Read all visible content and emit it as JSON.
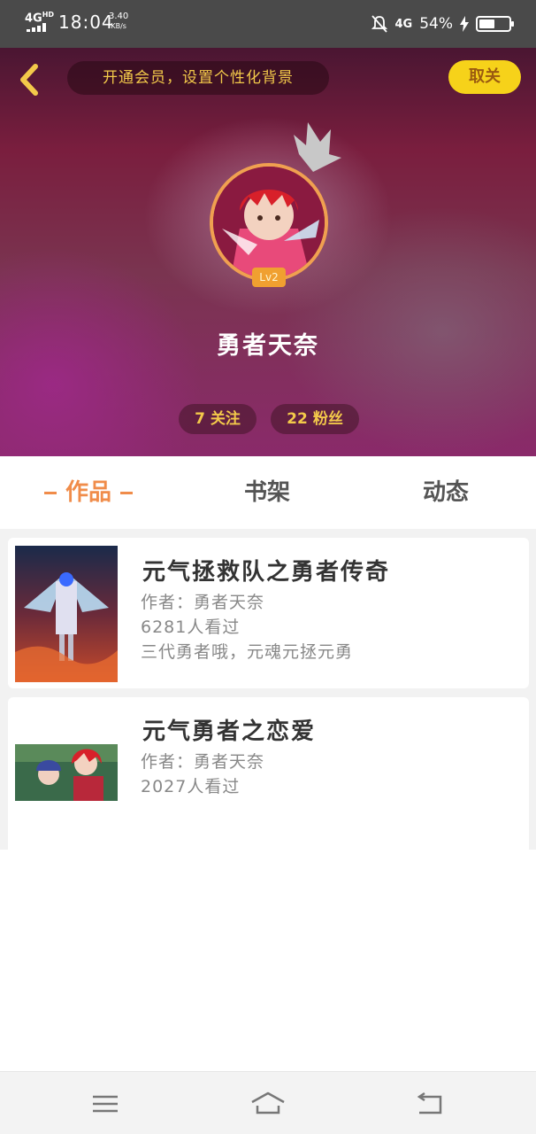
{
  "status_bar": {
    "network": "4G",
    "network_sup": "HD",
    "time": "18:04",
    "speed_value": "3.40",
    "speed_unit": "KB/s",
    "signal_label": "4G",
    "battery_percent": "54%",
    "battery_level": 0.54
  },
  "header": {
    "vip_banner": "开通会员，设置个性化背景",
    "unfollow_label": "取关",
    "level": "Lv2",
    "username": "勇者天奈",
    "following_count": "7",
    "following_label": "关注",
    "followers_count": "22",
    "followers_label": "粉丝"
  },
  "tabs": [
    {
      "label": "作品",
      "active": true
    },
    {
      "label": "书架",
      "active": false
    },
    {
      "label": "动态",
      "active": false
    }
  ],
  "works": [
    {
      "title": "元气拯救队之勇者传奇",
      "author": "作者：勇者天奈",
      "views": "6281人看过",
      "description": "三代勇者哦，元魂元拯元勇"
    },
    {
      "title": "元气勇者之恋爱",
      "author": "作者：勇者天奈",
      "views": "2027人看过"
    }
  ],
  "icons": {
    "back": "chevron-left-icon",
    "crown": "crown-icon",
    "menu": "menu-icon",
    "home": "home-icon",
    "back_nav": "back-icon"
  },
  "colors": {
    "accent": "#f08c4a",
    "gold": "#f3c94a",
    "unfollow_bg": "#f6d21a"
  }
}
